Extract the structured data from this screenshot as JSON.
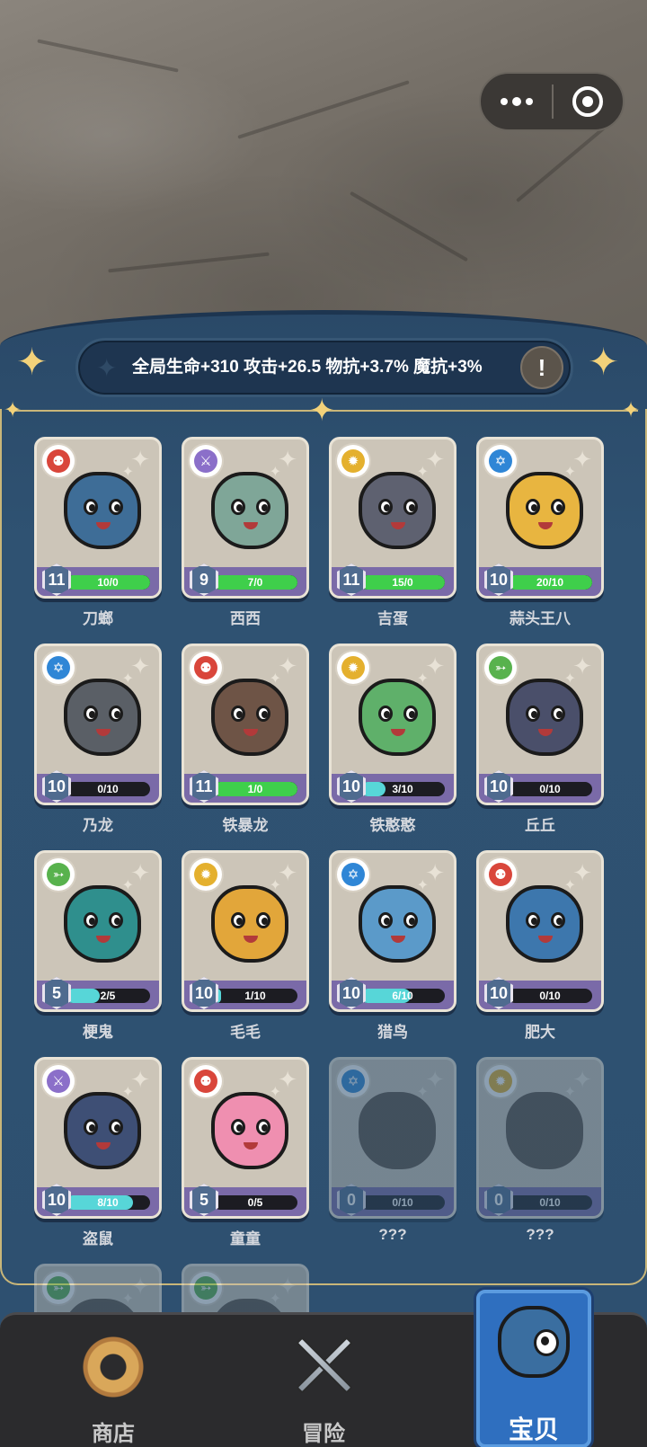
{
  "top_bar": {
    "more_icon": "ellipsis-icon",
    "close_icon": "target-icon"
  },
  "banner": {
    "text": "全局生命+310 攻击+26.5 物抗+3.7% 魔抗+3%",
    "info_label": "!"
  },
  "colors": {
    "health_bar": "#3fcf4b",
    "progress_bar": "#57d6d8",
    "type_red": "#d9463b",
    "type_purple": "#8b6fc9",
    "type_yellow": "#e4b02e",
    "type_blue": "#2f86d6",
    "type_green": "#58b24d"
  },
  "pets": [
    {
      "name": "刀螂",
      "level": "11",
      "progress": "10/0",
      "fill": 1.0,
      "bar": "health",
      "type_icon": "helmet-icon",
      "type_color": "#d9463b",
      "body_color": "#3e6d97",
      "locked": false
    },
    {
      "name": "西西",
      "level": "9",
      "progress": "7/0",
      "fill": 1.0,
      "bar": "health",
      "type_icon": "sword-icon",
      "type_color": "#8b6fc9",
      "body_color": "#7fa698",
      "locked": false
    },
    {
      "name": "吉蛋",
      "level": "11",
      "progress": "15/0",
      "fill": 1.0,
      "bar": "health",
      "type_icon": "sun-icon",
      "type_color": "#e4b02e",
      "body_color": "#5e6170",
      "locked": false
    },
    {
      "name": "蒜头王八",
      "level": "10",
      "progress": "20/10",
      "fill": 1.0,
      "bar": "health",
      "type_icon": "star-of-david-icon",
      "type_color": "#2f86d6",
      "body_color": "#e8b540",
      "locked": false
    },
    {
      "name": "乃龙",
      "level": "10",
      "progress": "0/10",
      "fill": 0.0,
      "bar": "progress",
      "type_icon": "star-of-david-icon",
      "type_color": "#2f86d6",
      "body_color": "#5a5f66",
      "locked": false
    },
    {
      "name": "铁暴龙",
      "level": "11",
      "progress": "1/0",
      "fill": 1.0,
      "bar": "health",
      "type_icon": "helmet-icon",
      "type_color": "#d9463b",
      "body_color": "#6e5446",
      "locked": false
    },
    {
      "name": "铁憨憨",
      "level": "10",
      "progress": "3/10",
      "fill": 0.3,
      "bar": "progress",
      "type_icon": "sun-icon",
      "type_color": "#e4b02e",
      "body_color": "#5fb06a",
      "locked": false
    },
    {
      "name": "丘丘",
      "level": "10",
      "progress": "0/10",
      "fill": 0.0,
      "bar": "progress",
      "type_icon": "bow-icon",
      "type_color": "#58b24d",
      "body_color": "#4a4f6a",
      "locked": false
    },
    {
      "name": "梗鬼",
      "level": "5",
      "progress": "2/5",
      "fill": 0.4,
      "bar": "progress",
      "type_icon": "bow-icon",
      "type_color": "#58b24d",
      "body_color": "#2f8f8d",
      "locked": false
    },
    {
      "name": "毛毛",
      "level": "10",
      "progress": "1/10",
      "fill": 0.1,
      "bar": "progress",
      "type_icon": "sun-icon",
      "type_color": "#e4b02e",
      "body_color": "#e2a63a",
      "locked": false
    },
    {
      "name": "猎鸟",
      "level": "10",
      "progress": "6/10",
      "fill": 0.6,
      "bar": "progress",
      "type_icon": "star-of-david-icon",
      "type_color": "#2f86d6",
      "body_color": "#5b9ac9",
      "locked": false
    },
    {
      "name": "肥大",
      "level": "10",
      "progress": "0/10",
      "fill": 0.0,
      "bar": "progress",
      "type_icon": "helmet-icon",
      "type_color": "#d9463b",
      "body_color": "#3d77ad",
      "locked": false
    },
    {
      "name": "盗鼠",
      "level": "10",
      "progress": "8/10",
      "fill": 0.8,
      "bar": "progress",
      "type_icon": "sword-icon",
      "type_color": "#8b6fc9",
      "body_color": "#3e4f75",
      "locked": false
    },
    {
      "name": "童童",
      "level": "5",
      "progress": "0/5",
      "fill": 0.0,
      "bar": "progress",
      "type_icon": "helmet-icon",
      "type_color": "#d9463b",
      "body_color": "#ef8fb0",
      "locked": false
    },
    {
      "name": "???",
      "level": "0",
      "progress": "0/10",
      "fill": 0.0,
      "bar": "progress",
      "type_icon": "star-of-david-icon",
      "type_color": "#2f86d6",
      "body_color": "#5a4f45",
      "locked": true
    },
    {
      "name": "???",
      "level": "0",
      "progress": "0/10",
      "fill": 0.0,
      "bar": "progress",
      "type_icon": "sun-icon",
      "type_color": "#e4b02e",
      "body_color": "#5a4f45",
      "locked": true
    },
    {
      "name": "",
      "level": "",
      "progress": "",
      "fill": 0.0,
      "bar": "progress",
      "type_icon": "bow-icon",
      "type_color": "#58b24d",
      "body_color": "#5a4f45",
      "locked": true
    },
    {
      "name": "",
      "level": "",
      "progress": "",
      "fill": 0.0,
      "bar": "progress",
      "type_icon": "bow-icon",
      "type_color": "#58b24d",
      "body_color": "#5a4f45",
      "locked": true
    }
  ],
  "nav": {
    "shop_label": "商店",
    "adventure_label": "冒险",
    "pets_label": "宝贝",
    "active": "宝贝"
  }
}
